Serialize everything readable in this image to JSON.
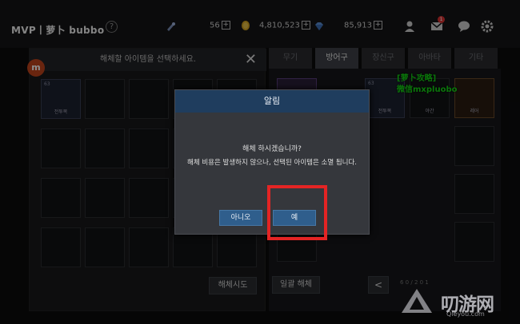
{
  "topbar": {
    "watermark": "MVP丨萝卜 bubbo",
    "help": "?",
    "stamina": "56",
    "gold": "4,810,523",
    "gems": "85,913",
    "plus": "+",
    "mail_badge": "1"
  },
  "left_panel": {
    "header": "해체할 아이템을 선택하세요.",
    "close": "✕",
    "disassemble_button": "해체시도",
    "item": {
      "level": "63",
      "name": "전투복"
    }
  },
  "right_panel": {
    "tabs": [
      "무기",
      "방어구",
      "장신구",
      "아바타",
      "기타"
    ],
    "active_tab": 1,
    "bulk_disassemble": "일괄 해체",
    "prev": "<",
    "page_info": "6 0 / 2 0 1",
    "items": [
      {
        "level": "63",
        "name": "전투복"
      },
      {
        "level": "",
        "name": "야간"
      },
      {
        "level": "",
        "name": "레어"
      }
    ],
    "overlay_line1": "[萝卜攻略]",
    "overlay_line2": "微信mxpluobo"
  },
  "dialog": {
    "title": "알림",
    "line1": "해체 하시겠습니까?",
    "line2": "해체 비용은 발생하지 않으나, 선택된 아이템은 소멸 됩니다.",
    "no_button": "아니오",
    "yes_button": "예"
  },
  "watermark": {
    "brand": "叨游网",
    "url": "Qieyou.com"
  },
  "colors": {
    "highlight": "#e42424",
    "dialog_title": "#1f3d5e",
    "dialog_button": "#2f5e8c",
    "overlay_text": "#14d814"
  }
}
